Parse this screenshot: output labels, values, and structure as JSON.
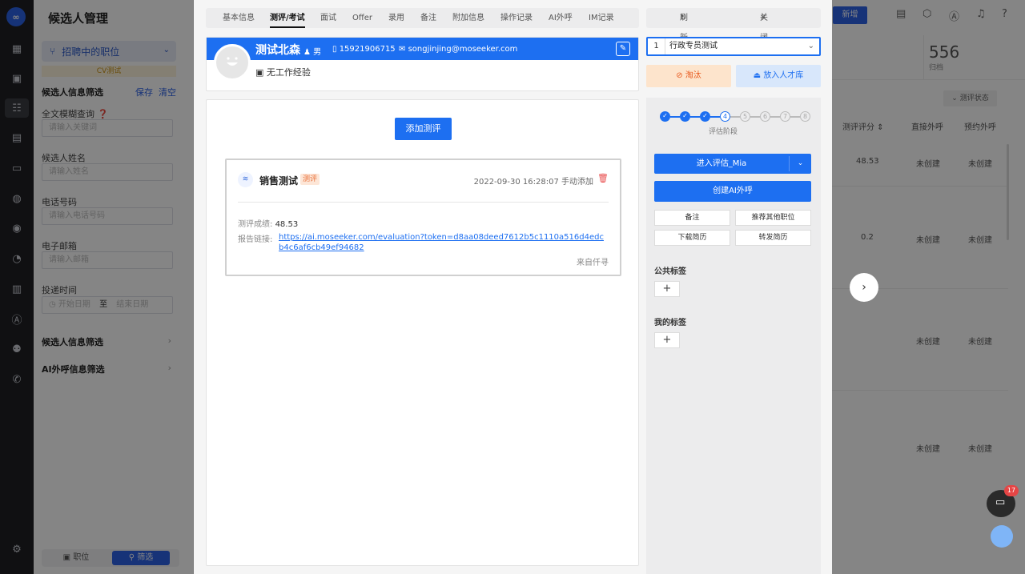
{
  "app": {
    "title": "候选人管理"
  },
  "sidebar_left": {
    "job_select": "招聘中的职位",
    "cv_tag": "CV测试",
    "filter_title": "候选人信息筛选",
    "save": "保存",
    "clear": "清空",
    "fields": [
      {
        "label": "全文模糊查询",
        "placeholder": "请输入关键词"
      },
      {
        "label": "候选人姓名",
        "placeholder": "请输入姓名"
      },
      {
        "label": "电话号码",
        "placeholder": "请输入电话号码"
      },
      {
        "label": "电子邮箱",
        "placeholder": "请输入邮箱"
      }
    ],
    "date_label": "投递时间",
    "date_start": "开始日期",
    "date_sep": "至",
    "date_end": "结束日期",
    "section1": "候选人信息筛选",
    "section2": "AI外呼信息筛选",
    "bottom_job": "职位",
    "bottom_filter": "筛选"
  },
  "modal": {
    "tabs": [
      "基本信息",
      "测评/考试",
      "面试",
      "Offer",
      "录用",
      "备注",
      "附加信息",
      "操作记录",
      "AI外呼",
      "IM记录"
    ],
    "active_tab": 1,
    "refresh": "刷新",
    "close": "关闭",
    "candidate": {
      "name": "测试北森",
      "gender": "男",
      "phone": "15921906715",
      "email": "songjinjing@moseeker.com",
      "experience": "无工作经验"
    },
    "add_eval_button": "添加测评",
    "eval_card": {
      "title": "销售测试",
      "tag": "测评",
      "datetime": "2022-09-30 16:28:07 手动添加",
      "score_label": "测评成绩:",
      "score": "48.53",
      "link_label": "报告链接:",
      "link": "https://ai.moseeker.com/evaluation?token=d8aa08deed7612b5c1110a516d4edcb4c6af6cb49ef94682",
      "source": "来自仟寻"
    },
    "right": {
      "select_num": "1",
      "select_text": "行政专员测试",
      "eliminate": "淘汰",
      "talent_pool": "放入人才库",
      "steps": [
        "1",
        "2",
        "3",
        "4",
        "5",
        "6",
        "7",
        "8"
      ],
      "current_step": 3,
      "stage_name": "评估阶段",
      "enter_button": "进入评估_Mia",
      "ai_call_button": "创建AI外呼",
      "small_buttons": [
        "备注",
        "推荐其他职位",
        "下载简历",
        "转发简历"
      ],
      "public_tags": "公共标签",
      "my_tags": "我的标签"
    }
  },
  "background_right": {
    "new_button": "新增",
    "count": "556",
    "count_label": "归档",
    "status_filter": "测评状态",
    "headers": [
      "测评评分",
      "直接外呼",
      "预约外呼"
    ],
    "rows": [
      [
        "48.53",
        "未创建",
        "未创建"
      ],
      [
        "0.2",
        "未创建",
        "未创建"
      ],
      [
        "",
        "未创建",
        "未创建"
      ],
      [
        "",
        "未创建",
        "未创建"
      ]
    ],
    "chat_badge": "17"
  }
}
